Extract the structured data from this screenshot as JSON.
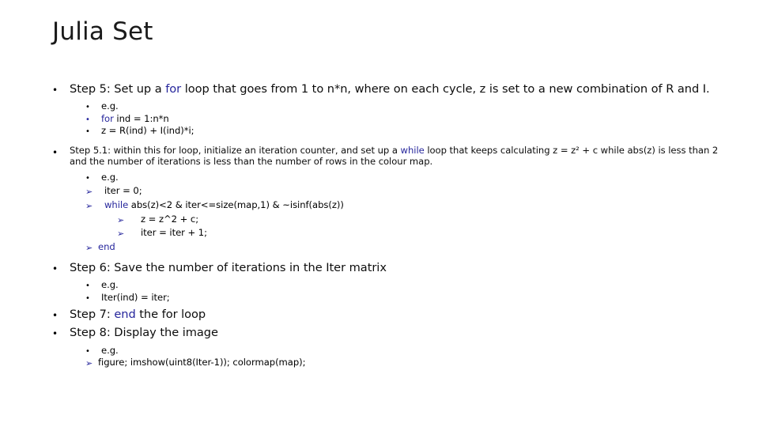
{
  "slide": {
    "title": "Julia Set",
    "accent_blue": "#26269c",
    "text_color": "#0d0d0d",
    "background": "#ffffff"
  },
  "bullets": {
    "bullet_glyph": "•",
    "arrow_glyph": "➢"
  },
  "content": {
    "step5": {
      "pre": "Step 5: Set up a ",
      "kw": "for",
      "post": " loop that goes from 1 to n*n, where on each cycle, z is set to a new combination of R and I."
    },
    "step5_sub": {
      "eg": "e.g.",
      "line1_kw": "for",
      "line1_rest": " ind = 1:n*n",
      "line2": "z = R(ind) + I(ind)*i;"
    },
    "step51": {
      "pre": "Step 5.1: within this for loop, initialize an iteration counter, and set up a ",
      "kw": "while",
      "post": " loop that keeps calculating z = z² + c while abs(z) is less than 2 and the number of iterations is less than the number of rows in the colour map."
    },
    "step51_sub": {
      "eg": "e.g.",
      "iter_init": "iter = 0;",
      "while_kw": "while",
      "while_rest": " abs(z)<2 & iter<=size(map,1) & ~isinf(abs(z))",
      "z_update": "z = z^2 + c;",
      "iter_inc": "iter = iter + 1;",
      "end_kw": "end"
    },
    "step6": {
      "text": "Step 6: Save the number of iterations in the Iter matrix"
    },
    "step6_sub": {
      "eg": "e.g.",
      "line1": "Iter(ind) = iter;"
    },
    "step7": {
      "pre": "Step 7: ",
      "kw": "end",
      "post": " the for loop"
    },
    "step8": {
      "text": "Step 8: Display the image"
    },
    "step8_sub": {
      "eg": "e.g.",
      "line1": "figure; imshow(uint8(Iter-1)); colormap(map);"
    }
  }
}
